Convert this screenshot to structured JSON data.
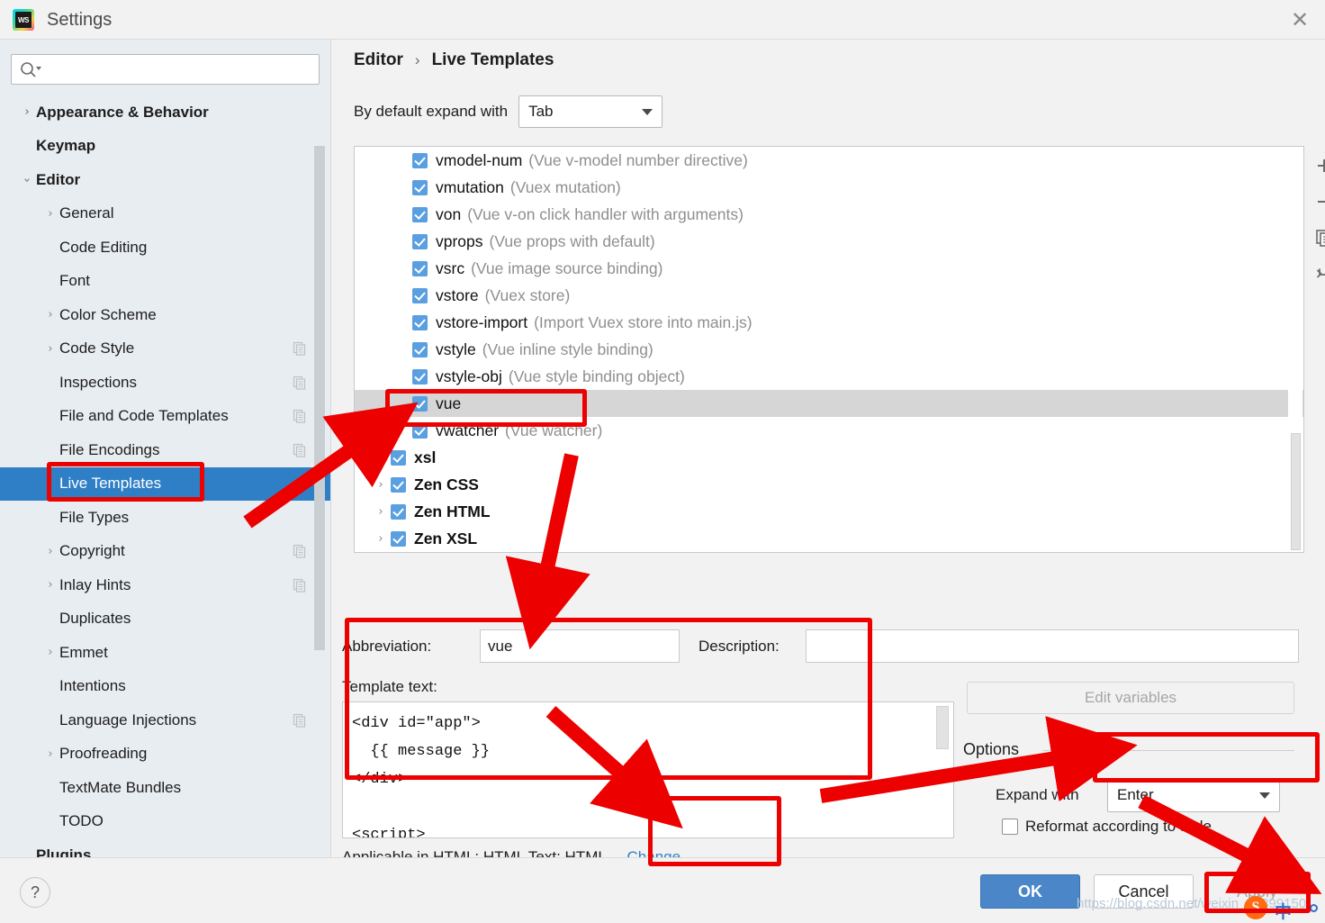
{
  "window": {
    "title": "Settings",
    "logo_icon": "webstorm-logo",
    "close_icon": "close-icon"
  },
  "sidebar": {
    "search": {
      "placeholder": "",
      "value": "",
      "icon": "search-icon"
    },
    "items": [
      {
        "label": "Appearance & Behavior",
        "depth": 0,
        "arrow": "right",
        "bold": true,
        "selected": false,
        "badge": false
      },
      {
        "label": "Keymap",
        "depth": 0,
        "arrow": "none",
        "bold": true,
        "selected": false,
        "badge": false
      },
      {
        "label": "Editor",
        "depth": 0,
        "arrow": "down",
        "bold": true,
        "selected": false,
        "badge": false
      },
      {
        "label": "General",
        "depth": 1,
        "arrow": "right",
        "bold": false,
        "selected": false,
        "badge": false
      },
      {
        "label": "Code Editing",
        "depth": 1,
        "arrow": "none",
        "bold": false,
        "selected": false,
        "badge": false
      },
      {
        "label": "Font",
        "depth": 1,
        "arrow": "none",
        "bold": false,
        "selected": false,
        "badge": false
      },
      {
        "label": "Color Scheme",
        "depth": 1,
        "arrow": "right",
        "bold": false,
        "selected": false,
        "badge": false
      },
      {
        "label": "Code Style",
        "depth": 1,
        "arrow": "right",
        "bold": false,
        "selected": false,
        "badge": true
      },
      {
        "label": "Inspections",
        "depth": 1,
        "arrow": "none",
        "bold": false,
        "selected": false,
        "badge": true
      },
      {
        "label": "File and Code Templates",
        "depth": 1,
        "arrow": "none",
        "bold": false,
        "selected": false,
        "badge": true
      },
      {
        "label": "File Encodings",
        "depth": 1,
        "arrow": "none",
        "bold": false,
        "selected": false,
        "badge": true
      },
      {
        "label": "Live Templates",
        "depth": 1,
        "arrow": "none",
        "bold": false,
        "selected": true,
        "badge": false
      },
      {
        "label": "File Types",
        "depth": 1,
        "arrow": "none",
        "bold": false,
        "selected": false,
        "badge": false
      },
      {
        "label": "Copyright",
        "depth": 1,
        "arrow": "right",
        "bold": false,
        "selected": false,
        "badge": true
      },
      {
        "label": "Inlay Hints",
        "depth": 1,
        "arrow": "right",
        "bold": false,
        "selected": false,
        "badge": true
      },
      {
        "label": "Duplicates",
        "depth": 1,
        "arrow": "none",
        "bold": false,
        "selected": false,
        "badge": false
      },
      {
        "label": "Emmet",
        "depth": 1,
        "arrow": "right",
        "bold": false,
        "selected": false,
        "badge": false
      },
      {
        "label": "Intentions",
        "depth": 1,
        "arrow": "none",
        "bold": false,
        "selected": false,
        "badge": false
      },
      {
        "label": "Language Injections",
        "depth": 1,
        "arrow": "none",
        "bold": false,
        "selected": false,
        "badge": true
      },
      {
        "label": "Proofreading",
        "depth": 1,
        "arrow": "right",
        "bold": false,
        "selected": false,
        "badge": false
      },
      {
        "label": "TextMate Bundles",
        "depth": 1,
        "arrow": "none",
        "bold": false,
        "selected": false,
        "badge": false
      },
      {
        "label": "TODO",
        "depth": 1,
        "arrow": "none",
        "bold": false,
        "selected": false,
        "badge": false
      },
      {
        "label": "Plugins",
        "depth": 0,
        "arrow": "none",
        "bold": true,
        "selected": false,
        "badge": false
      }
    ]
  },
  "main": {
    "breadcrumb": {
      "parent": "Editor",
      "separator": "›",
      "current": "Live Templates"
    },
    "expand_row": {
      "label": "By default expand with",
      "value": "Tab",
      "caret_icon": "chevron-down-icon"
    },
    "templates": [
      {
        "abbr": "vmodel-num",
        "desc": "(Vue v-model number directive)",
        "checked": true,
        "group": false,
        "selected": false
      },
      {
        "abbr": "vmutation",
        "desc": "(Vuex mutation)",
        "checked": true,
        "group": false,
        "selected": false
      },
      {
        "abbr": "von",
        "desc": "(Vue v-on click handler with arguments)",
        "checked": true,
        "group": false,
        "selected": false
      },
      {
        "abbr": "vprops",
        "desc": "(Vue props with default)",
        "checked": true,
        "group": false,
        "selected": false
      },
      {
        "abbr": "vsrc",
        "desc": "(Vue image source binding)",
        "checked": true,
        "group": false,
        "selected": false
      },
      {
        "abbr": "vstore",
        "desc": "(Vuex store)",
        "checked": true,
        "group": false,
        "selected": false
      },
      {
        "abbr": "vstore-import",
        "desc": "(Import Vuex store into main.js)",
        "checked": true,
        "group": false,
        "selected": false
      },
      {
        "abbr": "vstyle",
        "desc": "(Vue inline style binding)",
        "checked": true,
        "group": false,
        "selected": false
      },
      {
        "abbr": "vstyle-obj",
        "desc": "(Vue style binding object)",
        "checked": true,
        "group": false,
        "selected": false
      },
      {
        "abbr": "vue",
        "desc": "",
        "checked": true,
        "group": false,
        "selected": true
      },
      {
        "abbr": "vwatcher",
        "desc": "(Vue watcher)",
        "checked": true,
        "group": false,
        "selected": false
      },
      {
        "abbr": "xsl",
        "desc": "",
        "checked": true,
        "group": true,
        "selected": false
      },
      {
        "abbr": "Zen CSS",
        "desc": "",
        "checked": true,
        "group": true,
        "selected": false
      },
      {
        "abbr": "Zen HTML",
        "desc": "",
        "checked": true,
        "group": true,
        "selected": false
      },
      {
        "abbr": "Zen XSL",
        "desc": "",
        "checked": true,
        "group": true,
        "selected": false
      }
    ],
    "list_toolbar": [
      {
        "icon": "plus-icon",
        "name": "add-template-button"
      },
      {
        "icon": "minus-icon",
        "name": "remove-template-button"
      },
      {
        "icon": "copy-icon",
        "name": "duplicate-template-button"
      },
      {
        "icon": "revert-icon",
        "name": "reset-template-button"
      }
    ],
    "editor": {
      "abbreviation_label": "Abbreviation:",
      "abbreviation_value": "vue",
      "description_label": "Description:",
      "description_value": "",
      "template_text_label": "Template text:",
      "template_text_value": "<div id=\"app\">\n  {{ message }}\n</div>\n\n<script>",
      "applicable_text": "Applicable in HTML: HTML Text; HTML.",
      "change_link": "Change",
      "change_caret_icon": "chevron-down-icon"
    },
    "options": {
      "edit_variables_label": "Edit variables",
      "edit_variables_enabled": false,
      "group_label": "Options",
      "expand_with_label": "Expand with",
      "expand_with_value": "Enter",
      "reformat_label": "Reformat according to style",
      "reformat_checked": false
    }
  },
  "footer": {
    "help_icon": "question-mark-icon",
    "ok_label": "OK",
    "cancel_label": "Cancel",
    "apply_label": "Apply",
    "apply_enabled": false
  },
  "watermark": {
    "url": "https://blog.csdn.net/weixin_42899150",
    "ime_label": "中"
  },
  "colors": {
    "accent_blue": "#2f7fc7",
    "selection_blue": "#2f7fc7",
    "checkbox_blue": "#5a9fe0",
    "annotation_red": "#ec0000",
    "sidebar_bg": "#e8edf1",
    "panel_bg": "#f2f2f2",
    "link_blue": "#2f7fc7"
  }
}
